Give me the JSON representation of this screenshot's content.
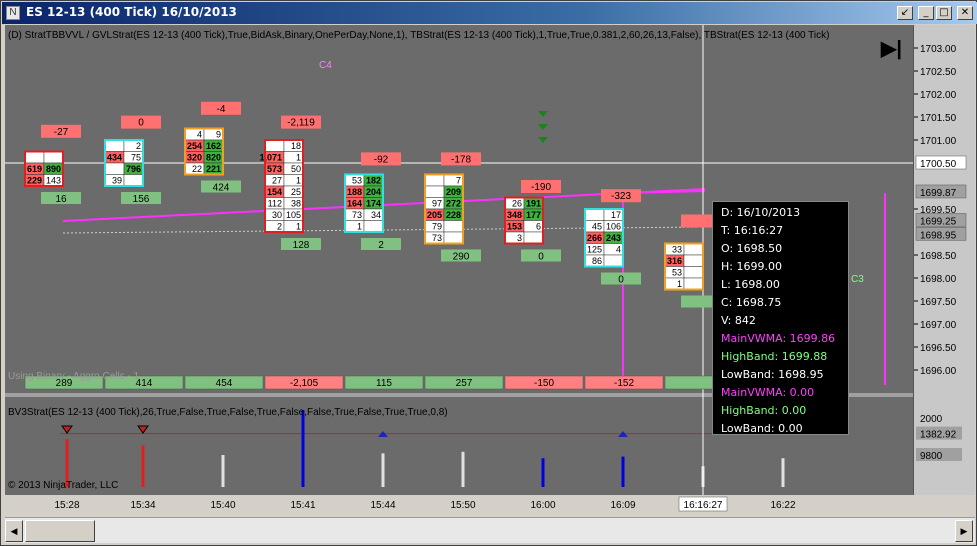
{
  "window": {
    "title": "ES 12-13 (400 Tick)  16/10/2013",
    "buttons": [
      "↙",
      "_",
      "□",
      "✕"
    ]
  },
  "chart": {
    "indicator_label_top": "(D) StratTBBVVL / GVLStrat(ES 12-13 (400 Tick),True,BidAsk,Binary,OnePerDay,None,1), TBStrat(ES 12-13 (400 Tick),1,True,True,0.381,2,60,26,13,False), TBStrat(ES 12-13 (400 Tick)",
    "indicator_label_bottom": "BV3Strat(ES 12-13 (400 Tick),26,True,False,True,False,True,False,False,True,False,True,True,0,8)",
    "watermark_using": "Using Binary - Aggro Cells - 1",
    "copyright": "© 2013 NinjaTrader, LLC",
    "annotations": [
      {
        "text": "C4",
        "price": 1702.65,
        "bar": 3.55
      },
      {
        "text": "C3",
        "price": 1698.0,
        "bar": 10.2
      }
    ],
    "price_ticks": [
      "1703.00",
      "1702.50",
      "1702.00",
      "1701.50",
      "1701.00",
      "1699.50",
      "1698.50",
      "1698.00",
      "1697.50",
      "1697.00",
      "1696.50",
      "1696.00"
    ],
    "price_ticks_values": [
      1703.0,
      1702.5,
      1702.0,
      1701.5,
      1701.0,
      1699.5,
      1698.5,
      1698.0,
      1697.5,
      1697.0,
      1696.5,
      1696.0
    ],
    "price_markers": [
      {
        "text": "1700.50",
        "value": 1700.5,
        "style": "white"
      },
      {
        "text": "1699.87",
        "value": 1699.87,
        "style": "gray"
      },
      {
        "text": "1699.25",
        "value": 1699.25,
        "style": "gray"
      },
      {
        "text": "1698.95",
        "value": 1698.95,
        "style": "gray"
      }
    ],
    "lower_ticks": [
      {
        "text": "2000",
        "value": 2000,
        "style": "plain"
      },
      {
        "text": "1382.92",
        "value": 1382.92,
        "style": "gray"
      },
      {
        "text": "9800",
        "value": 9800,
        "style": "gray"
      }
    ],
    "time_labels": [
      "15:28",
      "15:34",
      "15:40",
      "15:41",
      "15:44",
      "15:50",
      "16:00",
      "16:09",
      "16:16:27",
      "16:22"
    ],
    "crosshair_time": "16:16:27",
    "crosshair_price": 1700.5
  },
  "cells_rows": [
    {
      "bar": 0,
      "top_box": {
        "text": "-27",
        "price": 1701.2,
        "color": "#ff7070"
      },
      "bottom_box": {
        "text": "16",
        "color": "#80c080"
      },
      "cells": [
        [
          "",
          ""
        ],
        [
          "619",
          "890"
        ],
        [
          "229",
          "143"
        ]
      ],
      "start_price": 1700.75
    },
    {
      "bar": 1,
      "top_box": {
        "text": "0",
        "price": 1701.4,
        "color": "#ff7070"
      },
      "bottom_box": {
        "text": "156",
        "color": "#80c080"
      },
      "cells": [
        [
          "",
          "2"
        ],
        [
          "434",
          "75"
        ],
        [
          "",
          "796"
        ],
        [
          "39",
          ""
        ]
      ],
      "start_price": 1701.0
    },
    {
      "bar": 2,
      "top_box": {
        "text": "-4",
        "price": 1701.7,
        "color": "#ff7070"
      },
      "bottom_box": {
        "text": "424",
        "color": "#80c080"
      },
      "cells": [
        [
          "4",
          "9"
        ],
        [
          "254",
          "162"
        ],
        [
          "320",
          "820"
        ],
        [
          "22",
          "221"
        ]
      ],
      "start_price": 1701.25
    },
    {
      "bar": 3,
      "top_box": {
        "text": "-2,119",
        "price": 1701.4,
        "color": "#ff7070"
      },
      "bottom_box": {
        "text": "128",
        "color": "#80c080"
      },
      "cells": [
        [
          "",
          "18"
        ],
        [
          "1,071",
          "1"
        ],
        [
          "573",
          "50"
        ],
        [
          "27",
          "1"
        ],
        [
          "154",
          "25"
        ],
        [
          "112",
          "38"
        ],
        [
          "30",
          "105"
        ],
        [
          "2",
          "1"
        ]
      ],
      "start_price": 1701.0
    },
    {
      "bar": 4,
      "top_box": {
        "text": "-92",
        "price": 1700.6,
        "color": "#ff7070"
      },
      "bottom_box": {
        "text": "2",
        "color": "#80c080"
      },
      "cells": [
        [
          "53",
          "182"
        ],
        [
          "188",
          "204"
        ],
        [
          "164",
          "174"
        ],
        [
          "73",
          "34"
        ],
        [
          "1",
          ""
        ]
      ],
      "start_price": 1700.25
    },
    {
      "bar": 5,
      "top_box": {
        "text": "-178",
        "price": 1700.6,
        "color": "#ff7070"
      },
      "bottom_box": {
        "text": "290",
        "color": "#80c080"
      },
      "cells": [
        [
          "",
          "7"
        ],
        [
          "",
          "209"
        ],
        [
          "97",
          "272"
        ],
        [
          "205",
          "228"
        ],
        [
          "79",
          ""
        ],
        [
          "73",
          ""
        ]
      ],
      "start_price": 1700.25
    },
    {
      "bar": 6,
      "top_box": {
        "text": "-190",
        "price": 1700.0,
        "color": "#ff7070"
      },
      "bottom_box": {
        "text": "0",
        "color": "#80c080"
      },
      "cells": [
        [
          "26",
          "191"
        ],
        [
          "348",
          "177"
        ],
        [
          "153",
          "6"
        ],
        [
          "3",
          ""
        ]
      ],
      "start_price": 1699.75
    },
    {
      "bar": 7,
      "top_box": {
        "text": "-323",
        "price": 1699.8,
        "color": "#ff7070"
      },
      "bottom_box": {
        "text": "0",
        "color": "#80c080"
      },
      "cells": [
        [
          "",
          "17"
        ],
        [
          "45",
          "106"
        ],
        [
          "266",
          "243"
        ],
        [
          "125",
          "4"
        ],
        [
          "86",
          ""
        ]
      ],
      "start_price": 1699.5
    },
    {
      "bar": 8,
      "top_box": {
        "text": "",
        "price": 1699.25,
        "color": "#ff7070"
      },
      "bottom_box": {
        "text": "",
        "color": "#80c080"
      },
      "cells": [
        [
          "33",
          ""
        ],
        [
          "316",
          ""
        ],
        [
          "53",
          ""
        ],
        [
          "1",
          ""
        ]
      ],
      "start_price": 1698.75
    }
  ],
  "volume_boxes": [
    {
      "text": "289",
      "color": "#80c080"
    },
    {
      "text": "414",
      "color": "#80c080"
    },
    {
      "text": "454",
      "color": "#80c080"
    },
    {
      "text": "-2,105",
      "color": "#ff8080"
    },
    {
      "text": "115",
      "color": "#80c080"
    },
    {
      "text": "257",
      "color": "#80c080"
    },
    {
      "text": "-150",
      "color": "#ff8080"
    },
    {
      "text": "-152",
      "color": "#ff8080"
    },
    {
      "text": "",
      "color": "#80c080"
    }
  ],
  "lower_bars": [
    {
      "time_index": 0,
      "value": 1500,
      "color": "#e02020",
      "marker": "down"
    },
    {
      "time_index": 1,
      "value": 1300,
      "color": "#e02020",
      "marker": "down"
    },
    {
      "time_index": 2,
      "value": 1000,
      "color": "#e0e0e0"
    },
    {
      "time_index": 3,
      "value": 2400,
      "color": "#0000e0"
    },
    {
      "time_index": 4,
      "value": 1050,
      "color": "#e0e0e0",
      "marker": "up"
    },
    {
      "time_index": 5,
      "value": 1100,
      "color": "#e0e0e0"
    },
    {
      "time_index": 6,
      "value": 900,
      "color": "#0000e0"
    },
    {
      "time_index": 7,
      "value": 950,
      "color": "#0000e0",
      "marker": "up"
    },
    {
      "time_index": 8,
      "value": 650,
      "color": "#e0e0e0"
    },
    {
      "time_index": 9,
      "value": 900,
      "color": "#e0e0e0"
    }
  ],
  "lower_reference": 1382.92,
  "data_box": {
    "lines": [
      {
        "text": "D: 16/10/2013",
        "color": "#ffffff"
      },
      {
        "text": "T: 16:16:27",
        "color": "#ffffff"
      },
      {
        "text": "O: 1698.50",
        "color": "#ffffff"
      },
      {
        "text": "H: 1699.00",
        "color": "#ffffff"
      },
      {
        "text": "L: 1698.00",
        "color": "#ffffff"
      },
      {
        "text": "C: 1698.75",
        "color": "#ffffff"
      },
      {
        "text": "V: 842",
        "color": "#ffffff"
      },
      {
        "text": "MainVWMA: 1699.86",
        "color": "#ff40ff"
      },
      {
        "text": "HighBand: 1699.88",
        "color": "#80ff80"
      },
      {
        "text": "LowBand: 1698.95",
        "color": "#ffffff"
      },
      {
        "text": "MainVWMA: 0.00",
        "color": "#ff40ff"
      },
      {
        "text": "HighBand: 0.00",
        "color": "#80ff80"
      },
      {
        "text": "LowBand: 0.00",
        "color": "#ffffff"
      }
    ]
  },
  "colors": {
    "background": "#6b6b6b",
    "vwma": "#ff30ff",
    "crosshair": "#ffffff"
  }
}
